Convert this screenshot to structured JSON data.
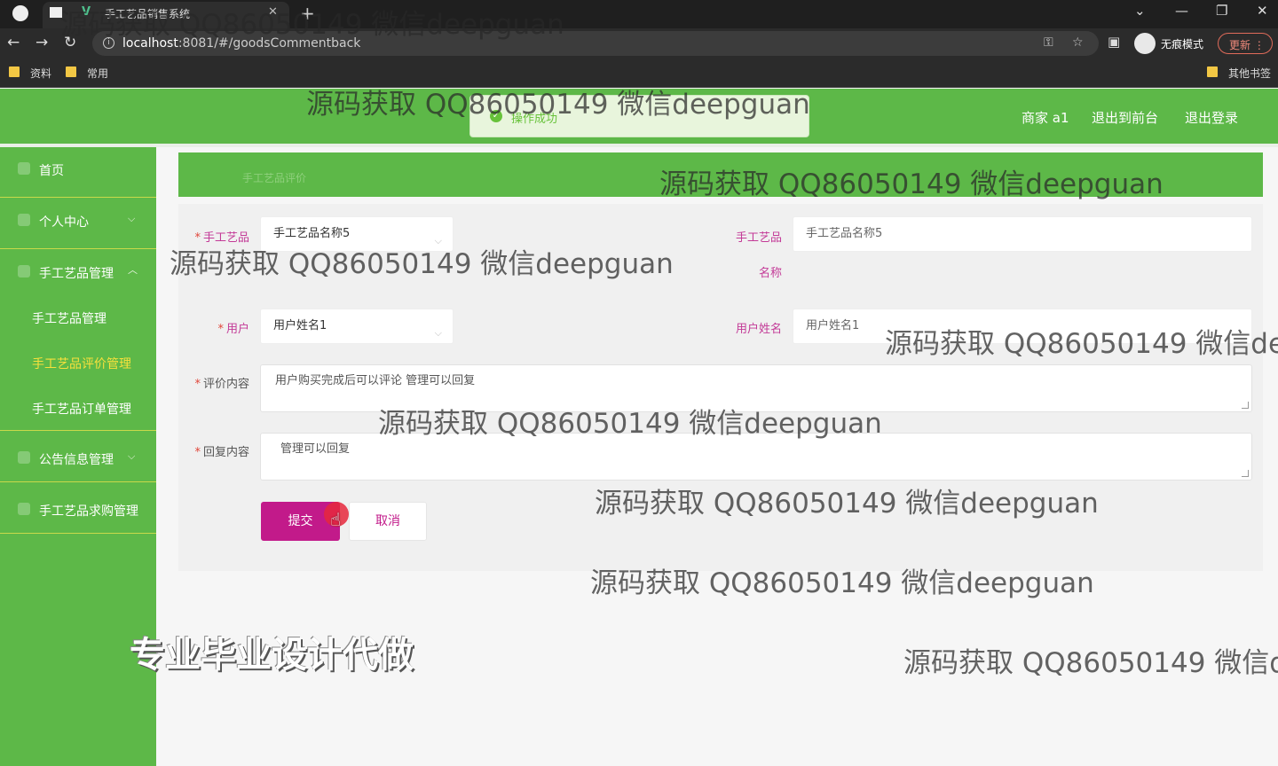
{
  "browser": {
    "tab_title": "手工艺品销售系统",
    "tab_favicon": "V",
    "url_host": "localhost",
    "url_rest": ":8081/#/goodsCommentback",
    "incognito_label": "无痕模式",
    "update_label": "更新",
    "bookmarks": [
      "资料",
      "常用"
    ],
    "other_bookmarks": "其他书签"
  },
  "header": {
    "user_label": "商家 a1",
    "back_to_front": "退出到前台",
    "logout": "退出登录",
    "toast": "操作成功"
  },
  "sidebar": {
    "home": "首页",
    "personal_center": "个人中心",
    "craft_management": "手工艺品管理",
    "sub_items": [
      "手工艺品管理",
      "手工艺品评价管理",
      "手工艺品订单管理"
    ],
    "notice_management": "公告信息管理",
    "purchase_management": "手工艺品求购管理"
  },
  "breadcrumb": "手工艺品评价",
  "form": {
    "craft_label": "手工艺品",
    "craft_value": "手工艺品名称5",
    "craft_name_label_1": "手工艺品",
    "craft_name_label_2": "名称",
    "craft_name_value": "手工艺品名称5",
    "user_label": "用户",
    "user_value": "用户姓名1",
    "user_name_label": "用户姓名",
    "user_name_value": "用户姓名1",
    "comment_label": "评价内容",
    "comment_value": "用户购买完成后可以评论  管理可以回复",
    "reply_label": "回复内容",
    "reply_value": "管理可以回复",
    "required_mark": "*",
    "submit": "提交",
    "cancel": "取消"
  },
  "watermarks": {
    "text": "源码获取 QQ86050149 微信deepguan",
    "text_cut1": "源码获取 QQ86050149 微信dee",
    "text_cut2": "源码获取 QQ86050149 微信de",
    "promo": "专业毕业设计代做"
  },
  "colors": {
    "accent_green": "#5db848",
    "primary_magenta": "#c21a8a",
    "active_menu": "#f7e03c"
  }
}
